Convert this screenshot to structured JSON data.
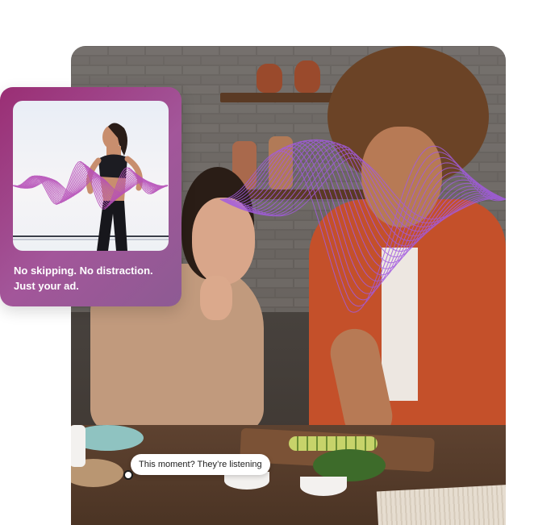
{
  "ad_card": {
    "caption_line1": "No skipping. No distraction.",
    "caption_line2": "Just your ad.",
    "gradient_colors": [
      "#9a2e74",
      "#a3569a",
      "#8d5b93"
    ]
  },
  "bubble": {
    "text": "This moment? They’re listening"
  },
  "colors": {
    "accent_wave": "#a35be0",
    "background": "#ffffff"
  },
  "icons": {
    "bubble_tail": "circle-dot-icon",
    "sound_wave": "sound-wave-graphic"
  }
}
